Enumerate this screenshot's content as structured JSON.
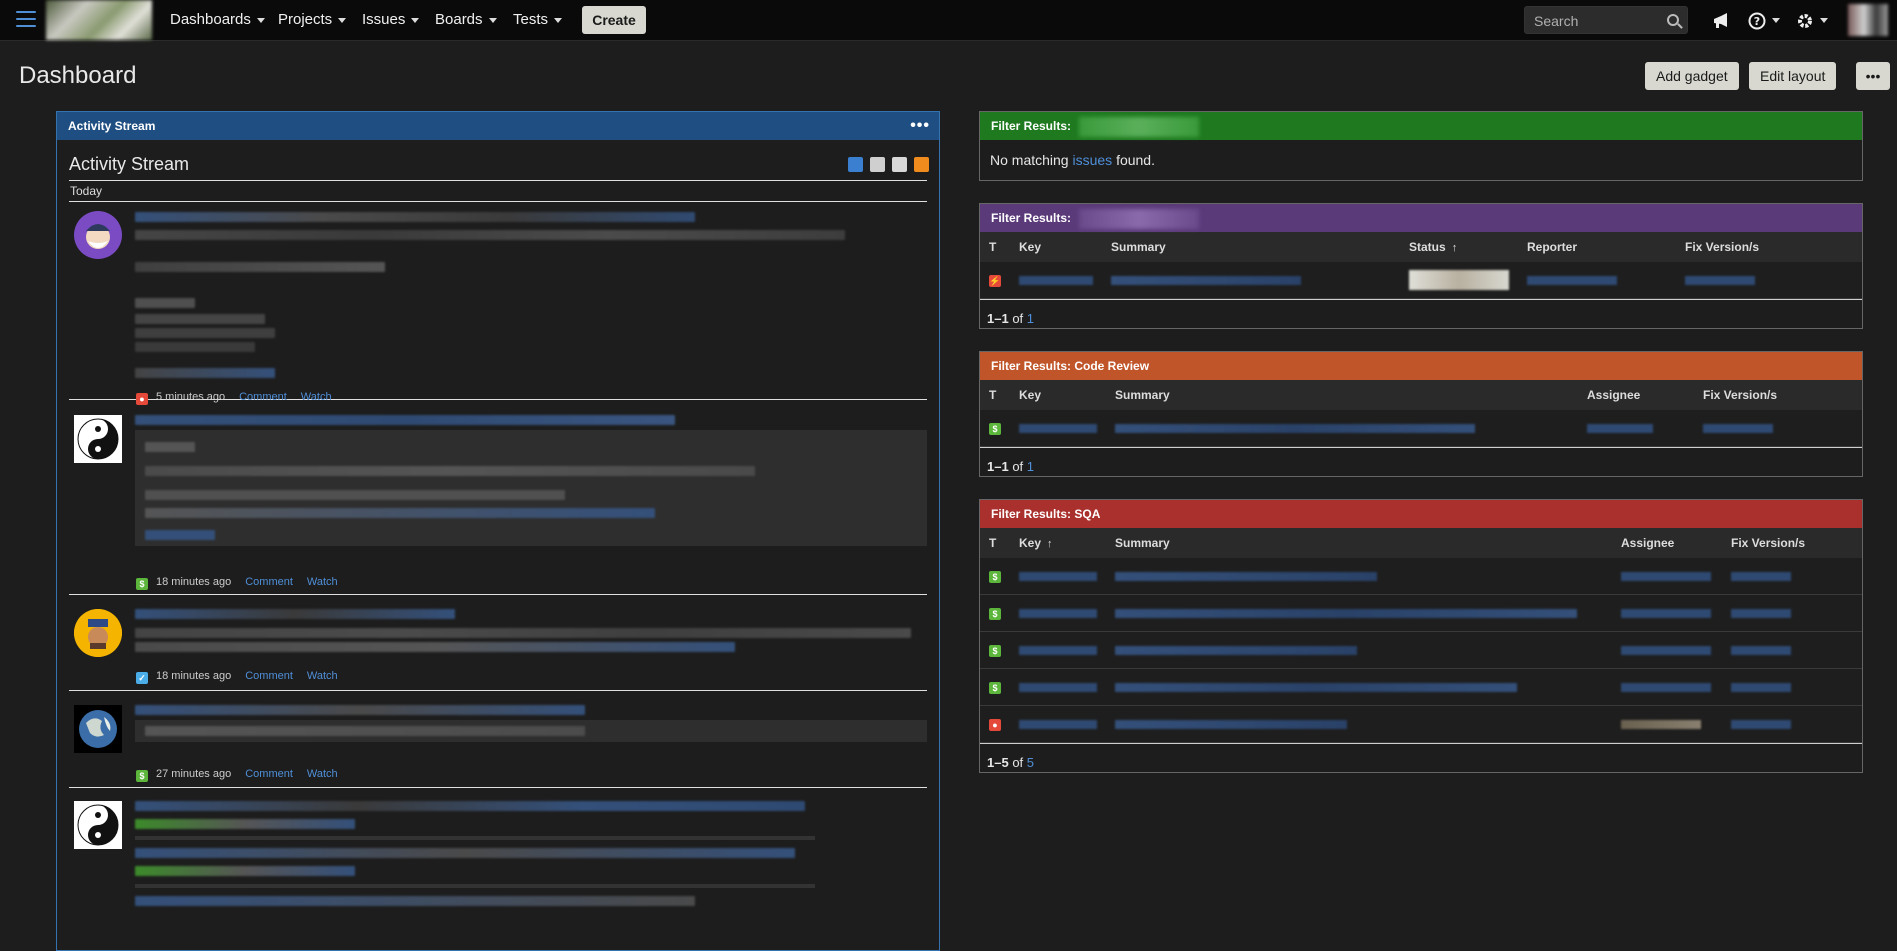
{
  "nav": {
    "items": [
      {
        "label": "Dashboards"
      },
      {
        "label": "Projects"
      },
      {
        "label": "Issues"
      },
      {
        "label": "Boards"
      },
      {
        "label": "Tests"
      }
    ],
    "create_label": "Create",
    "search_placeholder": "Search",
    "icons": [
      "hamburger-icon",
      "megaphone-icon",
      "help-icon",
      "gear-icon"
    ]
  },
  "page": {
    "title": "Dashboard",
    "add_gadget_label": "Add gadget",
    "edit_layout_label": "Edit layout",
    "more_label": "•••"
  },
  "activity_stream": {
    "gadget_title": "Activity Stream",
    "heading": "Activity Stream",
    "day_label": "Today",
    "comment_label": "Comment",
    "watch_label": "Watch",
    "entries": [
      {
        "time": "5 minutes ago",
        "type_color": "#e5493a",
        "avatar": "wizard"
      },
      {
        "time": "18 minutes ago",
        "type_color": "#5cb63b",
        "avatar": "yinyang"
      },
      {
        "time": "18 minutes ago",
        "type_color": "#4bade8",
        "avatar": "man"
      },
      {
        "time": "27 minutes ago",
        "type_color": "#5cb63b",
        "avatar": "earth"
      },
      {
        "time": "",
        "type_color": "#5cb63b",
        "avatar": "yinyang"
      }
    ]
  },
  "filters": {
    "green": {
      "title": "Filter Results:",
      "message_before": "No matching",
      "message_link": "issues",
      "message_after": "found."
    },
    "purple": {
      "title": "Filter Results:",
      "columns": [
        "T",
        "Key",
        "Summary",
        "Status",
        "Reporter",
        "Fix Version/s"
      ],
      "footer_range": "1–1",
      "footer_of": "of",
      "footer_total": "1"
    },
    "orange": {
      "title": "Filter Results: Code Review",
      "columns": [
        "T",
        "Key",
        "Summary",
        "Assignee",
        "Fix Version/s"
      ],
      "footer_range": "1–1",
      "footer_of": "of",
      "footer_total": "1"
    },
    "red": {
      "title": "Filter Results: SQA",
      "columns": [
        "T",
        "Key",
        "Summary",
        "Assignee",
        "Fix Version/s"
      ],
      "footer_range": "1–5",
      "footer_of": "of",
      "footer_total": "5"
    }
  },
  "colors": {
    "accent": "#4f8fd8",
    "story_green": "#5cb63b",
    "bug_red": "#e5493a",
    "task_blue": "#4bade8"
  }
}
